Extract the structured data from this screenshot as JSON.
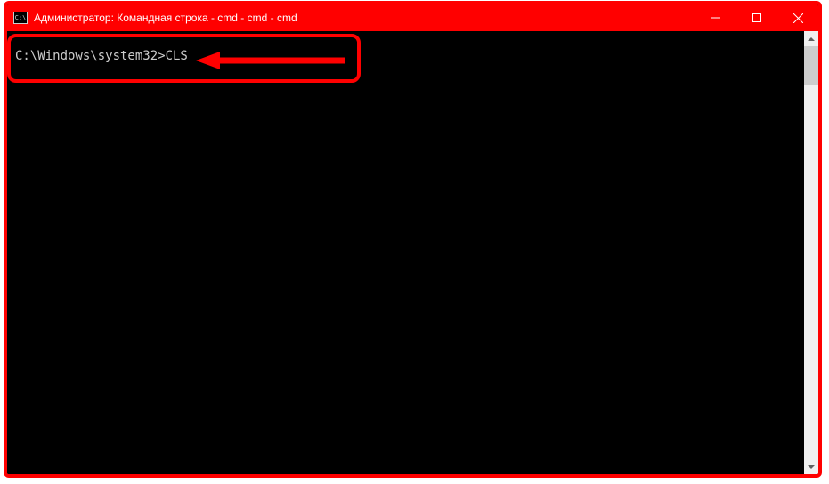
{
  "window": {
    "title": "Администратор: Командная строка - cmd - cmd - cmd",
    "app_icon_label": "C:\\"
  },
  "console": {
    "prompt": "C:\\Windows\\system32>",
    "command": "CLS"
  },
  "controls": {
    "minimize": "minimize",
    "maximize": "maximize",
    "close": "close"
  }
}
